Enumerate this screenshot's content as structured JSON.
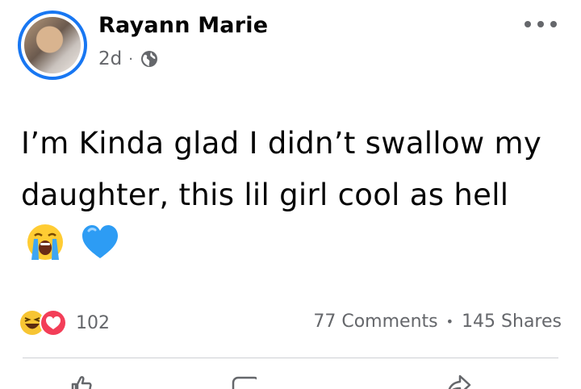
{
  "post": {
    "author": "Rayann Marie",
    "time": "2d",
    "meta_separator": "·",
    "privacy_icon": "globe-icon",
    "text": "I’m Kinda glad I didn’t swallow my daughter, this lil girl cool as hell",
    "emojis": [
      "crying-face",
      "blue-heart"
    ]
  },
  "reactions": {
    "icons": [
      "haha-icon",
      "love-icon"
    ],
    "count": "102"
  },
  "stats": {
    "comments": "77 Comments",
    "separator": "•",
    "shares": "145 Shares"
  },
  "actions": [
    {
      "name": "like",
      "icon": "like-icon"
    },
    {
      "name": "comment",
      "icon": "comment-icon"
    },
    {
      "name": "share",
      "icon": "share-icon"
    }
  ],
  "colors": {
    "accent": "#1877f2",
    "secondary_text": "#65676b",
    "primary_text": "#050505"
  }
}
